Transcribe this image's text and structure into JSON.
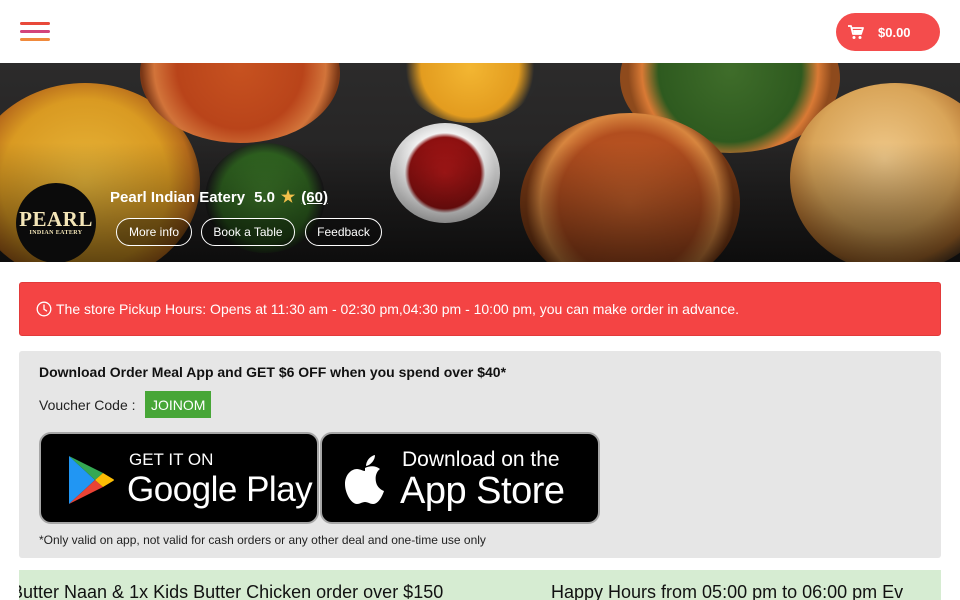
{
  "header": {
    "cart_total": "$0.00",
    "menu_icon": "hamburger-icon",
    "cart_icon": "cart-icon"
  },
  "store": {
    "name": "Pearl Indian Eatery",
    "rating": "5.0",
    "star": "★",
    "review_count": "(60)",
    "logo_line1": "PEARL",
    "logo_line2": "INDIAN EATERY",
    "buttons": {
      "more_info": "More info",
      "book_table": "Book a Table",
      "feedback": "Feedback"
    }
  },
  "alert": {
    "icon": "clock-icon",
    "text": "The store Pickup Hours: Opens at 11:30 am - 02:30 pm,04:30 pm - 10:00 pm, you can make order in advance."
  },
  "promo": {
    "title": "Download Order Meal App and GET $6 OFF when you spend over $40*",
    "voucher_label": "Voucher Code :",
    "voucher_code": "JOINOM",
    "google_play": {
      "small": "GET IT ON",
      "big": "Google Play"
    },
    "app_store": {
      "small": "Download on the",
      "big": "App Store"
    },
    "note": "*Only valid on app, not valid for cash orders or any other deal and one-time use only"
  },
  "marquee": {
    "item1": "Butter Naan & 1x Kids Butter Chicken order over $150",
    "item2": "Happy Hours from 05:00 pm to 06:00 pm Ev"
  },
  "colors": {
    "accent": "#f44c4c",
    "alert_bg": "#f44444",
    "voucher_bg": "#47a637",
    "marquee_bg": "#d6ecd2"
  }
}
